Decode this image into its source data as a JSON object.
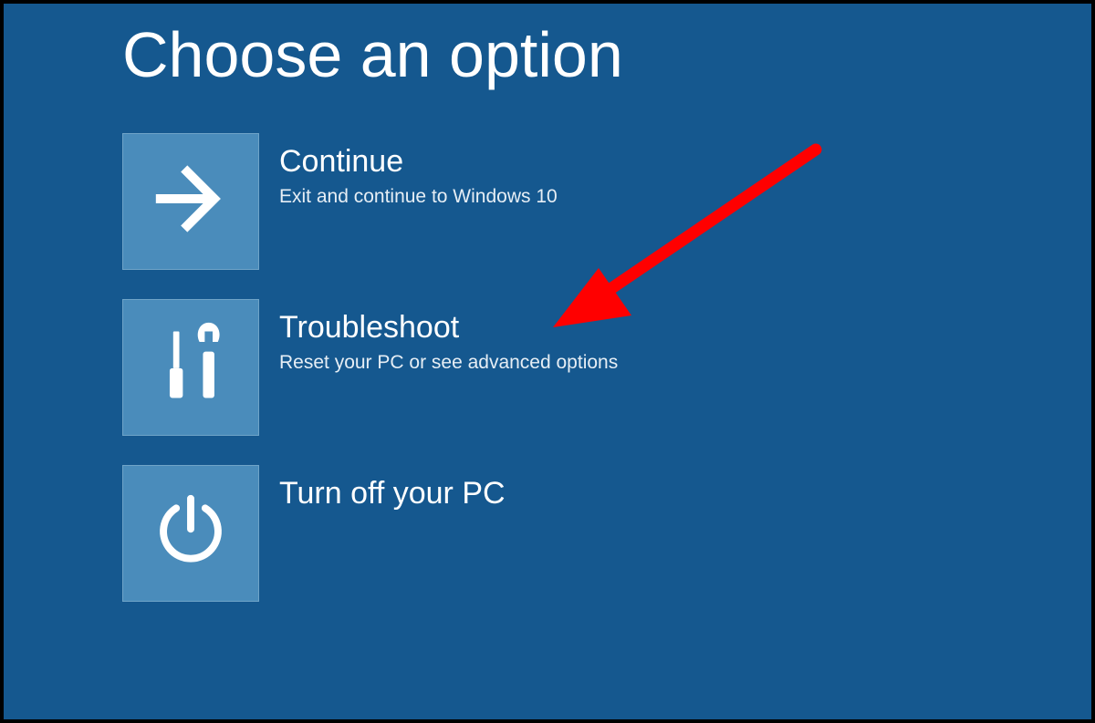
{
  "colors": {
    "background": "#15588f",
    "tile": "#4a8cbb",
    "tile_border": "#6fa4c8",
    "annotation": "#ff0000",
    "text": "#ffffff"
  },
  "title": "Choose an option",
  "options": [
    {
      "icon": "arrow-right-icon",
      "title": "Continue",
      "description": "Exit and continue to Windows 10"
    },
    {
      "icon": "tools-icon",
      "title": "Troubleshoot",
      "description": "Reset your PC or see advanced options"
    },
    {
      "icon": "power-icon",
      "title": "Turn off your PC",
      "description": ""
    }
  ],
  "annotation": {
    "type": "arrow",
    "color": "#ff0000",
    "points_to": "Troubleshoot"
  }
}
